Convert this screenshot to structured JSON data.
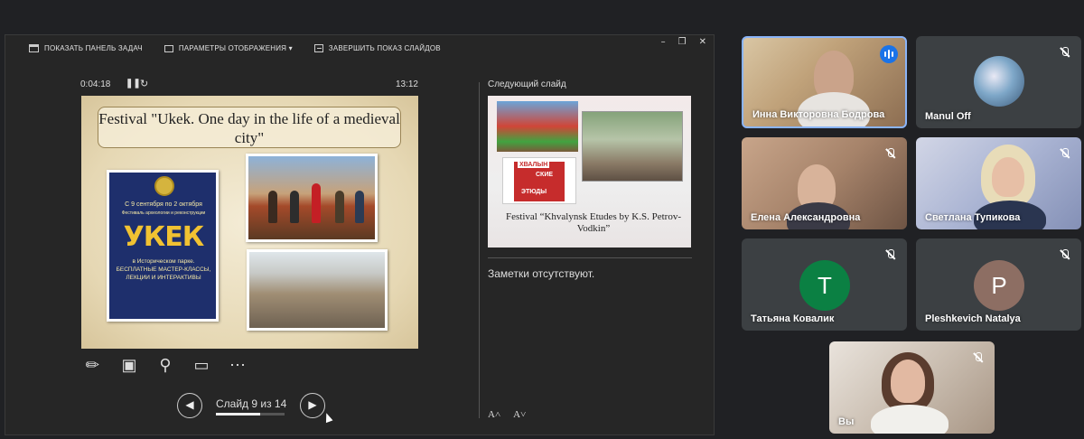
{
  "presenter": {
    "toolbar": {
      "taskbar": "ПОКАЗАТЬ ПАНЕЛЬ ЗАДАЧ",
      "display": "ПАРАМЕТРЫ ОТОБРАЖЕНИЯ ▾",
      "end": "ЗАВЕРШИТЬ ПОКАЗ СЛАЙДОВ"
    },
    "window": {
      "minimize": "–",
      "restore": "❐",
      "close": "✕"
    },
    "timer": {
      "elapsed": "0:04:18",
      "pause": "❚❚",
      "restart": "↻",
      "clock": "13:12"
    },
    "slide": {
      "title": "Festival \"Ukek. One day in the life of a medieval city\"",
      "poster": {
        "date": "С 9 сентября по 2 октября",
        "subtitle": "Фестиваль археологии и реконструкции",
        "headline": "УКЕК",
        "desc": "в Историческом парке. БЕСПЛАТНЫЕ МАСТЕР-КЛАССЫ, ЛЕКЦИИ И ИНТЕРАКТИВЫ"
      }
    },
    "nav": {
      "prev": "◀",
      "next": "▶",
      "label": "Слайд 9 из 14",
      "progress": 0.64
    },
    "next_slide": {
      "label": "Следующий слайд",
      "logo_line1": "ХВАЛЫН",
      "logo_line2": "СКИЕ",
      "logo_line3": "ЭТЮДЫ",
      "caption": "Festival “Khvalynsk Etudes by K.S. Petrov-Vodkin”"
    },
    "notes": "Заметки отсутствуют.",
    "font_up": "A˄",
    "font_down": "A˅"
  },
  "participants": {
    "inna": {
      "name": "Инна Викторовна Бодрова"
    },
    "manul": {
      "name": "Manul Off"
    },
    "elena": {
      "name": "Елена Александровна"
    },
    "svetlana": {
      "name": "Светлана Тупикова"
    },
    "tatyana": {
      "name": "Татьяна Ковалик",
      "initial": "T",
      "color": "#0b8043"
    },
    "pleshkevich": {
      "name": "Pleshkevich Natalya",
      "initial": "P",
      "color": "#8d6e63"
    },
    "you": {
      "name": "Вы"
    }
  }
}
